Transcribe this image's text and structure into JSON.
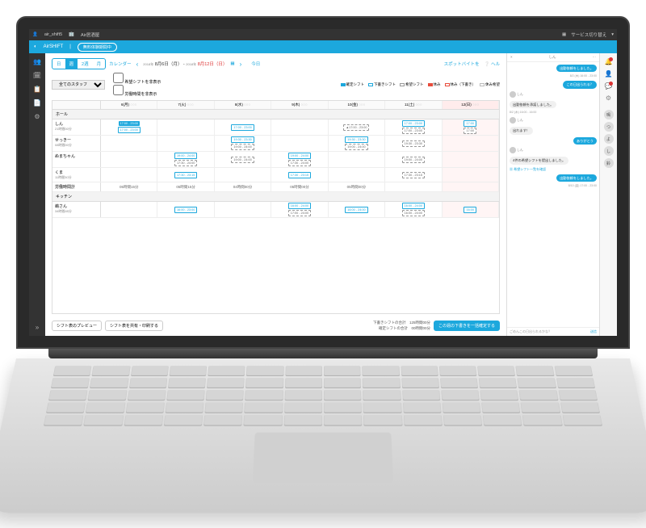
{
  "titlebar": {
    "user": "air_shift5",
    "store": "Air居酒屋",
    "switch_label": "サービス切り替え"
  },
  "appbar": {
    "brand": "AirSHIFT",
    "status": "無料体験期間中"
  },
  "leftnav_icons": [
    "people",
    "calendar",
    "clipboard",
    "chart",
    "gear"
  ],
  "view_tabs": [
    "日",
    "週",
    "2週",
    "月"
  ],
  "view_active": "週",
  "calendar_label": "カレンダー",
  "year": "2018年",
  "date_start": "8月6日（月）",
  "date_end": "8月12日（日）",
  "today_label": "今日",
  "spot_label": "スポットバイトを",
  "help_label": "ヘル",
  "staff_filter": "全てのスタッフ",
  "hide_hope": "希望シフトを非表示",
  "hide_hours": "労働時間を非表示",
  "legend": [
    {
      "color": "#1ca8dd",
      "label": "確定シフト"
    },
    {
      "color": "#fff",
      "border": "#1ca8dd",
      "label": "下書きシフト"
    },
    {
      "color": "#fff",
      "border": "#999",
      "label": "希望シフト"
    },
    {
      "color": "#e74c3c",
      "label": "休み"
    },
    {
      "color": "#fff",
      "border": "#e74c3c",
      "label": "休み（下書き）"
    },
    {
      "color": "#fff",
      "border": "#bbb",
      "label": "休み希望"
    }
  ],
  "days": [
    "6(月)",
    "7(火)",
    "8(水)",
    "9(木)",
    "10(金)",
    "11(土)",
    "12(日)"
  ],
  "sections": [
    {
      "title": "ホール",
      "rows": [
        {
          "name": "しん",
          "sub": "21時間00分",
          "cells": [
            [
              {
                "t": "17:00 - 23:00",
                "k": "confirmed"
              },
              {
                "t": "17:00 - 23:00",
                "k": "draft"
              }
            ],
            [],
            [
              {
                "t": "17:00 - 23:00",
                "k": "draft"
              }
            ],
            [],
            [
              {
                "t": "▲17:00 - 23:00",
                "k": "hope"
              }
            ],
            [
              {
                "t": "17:00 - 23:00",
                "k": "draft"
              },
              {
                "t": "17:00 - 23:00",
                "k": "hope"
              }
            ],
            [
              {
                "t": "17:00",
                "k": "draft"
              },
              {
                "t": "17:00",
                "k": "hope"
              }
            ]
          ]
        },
        {
          "name": "せっきー",
          "sub": "08時間00分",
          "cells": [
            [],
            [],
            [
              {
                "t": "19:30 - 23:30",
                "k": "draft"
              },
              {
                "t": "19:00 - 24:00",
                "k": "hope"
              }
            ],
            [],
            [
              {
                "t": "19:30 - 23:30",
                "k": "draft"
              },
              {
                "t": "19:00 - 24:00",
                "k": "hope"
              }
            ],
            [
              {
                "t": "19:30 - 23:30",
                "k": "hope"
              }
            ],
            []
          ]
        },
        {
          "name": "ぬまちゃん",
          "sub": "",
          "cells": [
            [],
            [
              {
                "t": "19:00 - 24:00",
                "k": "draft"
              },
              {
                "t": "17:30 - 24:00",
                "k": "hope"
              }
            ],
            [
              {
                "t": "19:00 - 24:00",
                "k": "hope"
              }
            ],
            [
              {
                "t": "19:00 - 24:00",
                "k": "draft"
              },
              {
                "t": "17:30 - 24:00",
                "k": "hope"
              }
            ],
            [],
            [
              {
                "t": "19:00 - 24:00",
                "k": "hope"
              }
            ],
            []
          ]
        },
        {
          "name": "くま",
          "sub": "11時間30分",
          "cells": [
            [],
            [
              {
                "t": "17:30 - 23:15",
                "k": "draft"
              }
            ],
            [],
            [
              {
                "t": "17:30 - 23:15",
                "k": "draft"
              }
            ],
            [],
            [
              {
                "t": "17:30 - 23:15",
                "k": "hope"
              }
            ],
            []
          ]
        },
        {
          "name": "労働時間計",
          "sub": "",
          "cells": [
            [
              "05時間15分"
            ],
            [
              "05時間15分"
            ],
            [
              "04時間00分"
            ],
            [
              "05時間00分"
            ],
            [
              "05時間00分"
            ],
            [
              ""
            ],
            [
              ""
            ]
          ],
          "is_total": true
        }
      ]
    },
    {
      "title": "キッチン",
      "rows": [
        {
          "name": "嶋さん",
          "sub": "34時間45分",
          "cells": [
            [],
            [
              {
                "t": "16:00 - 23:00",
                "k": "draft"
              }
            ],
            [],
            [
              {
                "t": "16:00 - 24:00",
                "k": "draft"
              },
              {
                "t": "17:00 - 24:00",
                "k": "hope"
              }
            ],
            [
              {
                "t": "16:00 - 24:00",
                "k": "draft"
              }
            ],
            [
              {
                "t": "16:00 - 24:00",
                "k": "draft"
              },
              {
                "t": "16:00 - 24:00",
                "k": "hope"
              }
            ],
            [
              {
                "t": "16:00",
                "k": "draft"
              }
            ]
          ]
        }
      ]
    }
  ],
  "actions": {
    "preview": "シフト表のプレビュー",
    "share": "シフト表を共有・印刷する",
    "confirm": "この週の下書きを一括確定する"
  },
  "summary": {
    "draft_label": "下書きシフトの合計",
    "draft_val": "125時間00分",
    "confirmed_label": "確定シフトの合計",
    "confirmed_val": "00時間00分"
  },
  "chat": {
    "name": "しん",
    "messages": [
      {
        "dir": "out",
        "text": "出勤依頼をしました。",
        "meta": "8/2 (木) 16:00 - 23:00"
      },
      {
        "dir": "out",
        "text": "この日出られる？"
      },
      {
        "dir": "in",
        "name": "しん",
        "text": "出勤依頼を承諾しました。",
        "meta": "8/2 (木) 16:00 - 16:00"
      },
      {
        "dir": "in",
        "name": "しん",
        "text": "出れます！"
      },
      {
        "dir": "out",
        "text": "ありがとう"
      },
      {
        "dir": "in",
        "name": "しん",
        "text": "4件の希望シフトを提出しました。",
        "link": "希望シフト一覧を確認"
      },
      {
        "dir": "out",
        "text": "出勤依頼をしました。",
        "meta": "8/10 (金) 17:00 - 23:00"
      }
    ],
    "footer": "ごめんこの日出られるかな？",
    "footer_btn": "送信"
  },
  "right_staff": [
    "鳴",
    "つ",
    "よ",
    "し",
    "鈴"
  ]
}
